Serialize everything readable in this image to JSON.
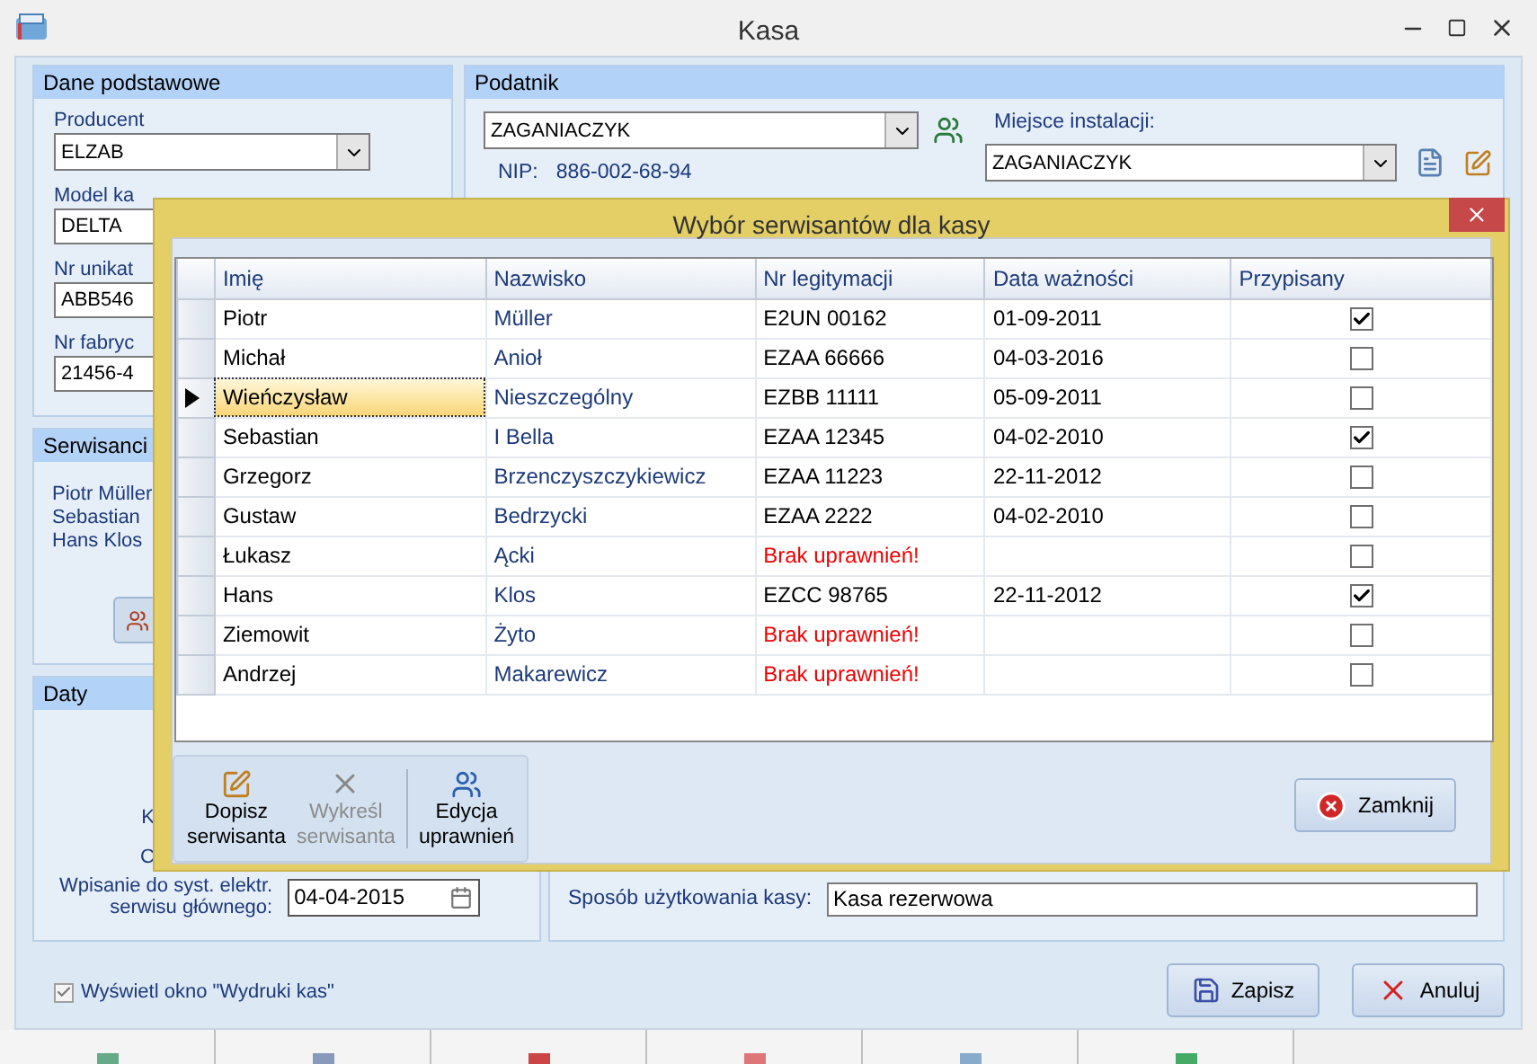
{
  "window": {
    "title": "Kasa"
  },
  "basic_data": {
    "title": "Dane podstawowe",
    "fields": [
      {
        "label": "Producent",
        "value": "ELZAB",
        "kind": "select"
      },
      {
        "label": "Model ka",
        "value": "DELTA",
        "kind": "text"
      },
      {
        "label": "Nr unikat",
        "value": "ABB546",
        "kind": "text"
      },
      {
        "label": "Nr fabryc",
        "value": "21456-4",
        "kind": "text"
      }
    ]
  },
  "technicians": {
    "title": "Serwisanci",
    "names": [
      "Piotr Müller",
      "Sebastian",
      "Hans Klos"
    ]
  },
  "dates": {
    "title": "Daty",
    "labels": [
      "K",
      "C"
    ],
    "main_service": {
      "label_lines": [
        "Wpisanie do syst. elektr.",
        "serwisu głównego:"
      ],
      "value": "04-04-2015"
    }
  },
  "show_prints": {
    "label": "Wyświetl okno \"Wydruki kas\"",
    "checked": true
  },
  "taxpayer": {
    "title": "Podatnik",
    "value": "ZAGANIACZYK",
    "nip_label": "NIP:",
    "nip": "886-002-68-94",
    "install_label": "Miejsce instalacji:",
    "install_value": "ZAGANIACZYK"
  },
  "usage": {
    "label": "Sposób użytkowania kasy:",
    "value": "Kasa rezerwowa"
  },
  "buttons": [
    {
      "label": "Zapisz",
      "kind": "save"
    },
    {
      "label": "Anuluj",
      "kind": "cancel"
    }
  ],
  "dialog": {
    "title": "Wybór serwisantów dla kasy",
    "columns": [
      "Imię",
      "Nazwisko",
      "Nr legitymacji",
      "Data ważności",
      "Przypisany"
    ],
    "rows": [
      {
        "first": "Piotr",
        "last": "Müller",
        "id": "E2UN 00162",
        "valid": "01-09-2011",
        "assigned": true,
        "no_rights": false,
        "selected": false
      },
      {
        "first": "Michał",
        "last": "Anioł",
        "id": "EZAA 66666",
        "valid": "04-03-2016",
        "assigned": false,
        "no_rights": false,
        "selected": false
      },
      {
        "first": "Wieńczysław",
        "last": "Nieszczególny",
        "id": "EZBB 11111",
        "valid": "05-09-2011",
        "assigned": false,
        "no_rights": false,
        "selected": true
      },
      {
        "first": "Sebastian",
        "last": "I Bella",
        "id": "EZAA 12345",
        "valid": "04-02-2010",
        "assigned": true,
        "no_rights": false,
        "selected": false
      },
      {
        "first": "Grzegorz",
        "last": "Brzenczyszczykiewicz",
        "id": "EZAA 11223",
        "valid": "22-11-2012",
        "assigned": false,
        "no_rights": false,
        "selected": false
      },
      {
        "first": "Gustaw",
        "last": "Bedrzycki",
        "id": "EZAA 2222",
        "valid": "04-02-2010",
        "assigned": false,
        "no_rights": false,
        "selected": false
      },
      {
        "first": "Łukasz",
        "last": "Ącki",
        "id": "Brak uprawnień!",
        "assigned": false,
        "no_rights": true,
        "selected": false
      },
      {
        "first": "Hans",
        "last": "Klos",
        "id": "EZCC 98765",
        "valid": "22-11-2012",
        "assigned": true,
        "no_rights": false,
        "selected": false
      },
      {
        "first": "Ziemowit",
        "last": "Żyto",
        "id": "Brak uprawnień!",
        "assigned": false,
        "no_rights": true,
        "selected": false
      },
      {
        "first": "Andrzej",
        "last": "Makarewicz",
        "id": "Brak uprawnień!",
        "assigned": false,
        "no_rights": true,
        "selected": false
      }
    ],
    "tools": [
      {
        "lines": [
          "Dopisz",
          "serwisanta"
        ],
        "kind": "add",
        "disabled": false
      },
      {
        "lines": [
          "Wykreśl",
          "serwisanta"
        ],
        "kind": "remove",
        "disabled": true
      },
      {
        "lines": [
          "Edycja",
          "uprawnień"
        ],
        "kind": "rights",
        "disabled": false
      }
    ],
    "close": "Zamknij"
  }
}
